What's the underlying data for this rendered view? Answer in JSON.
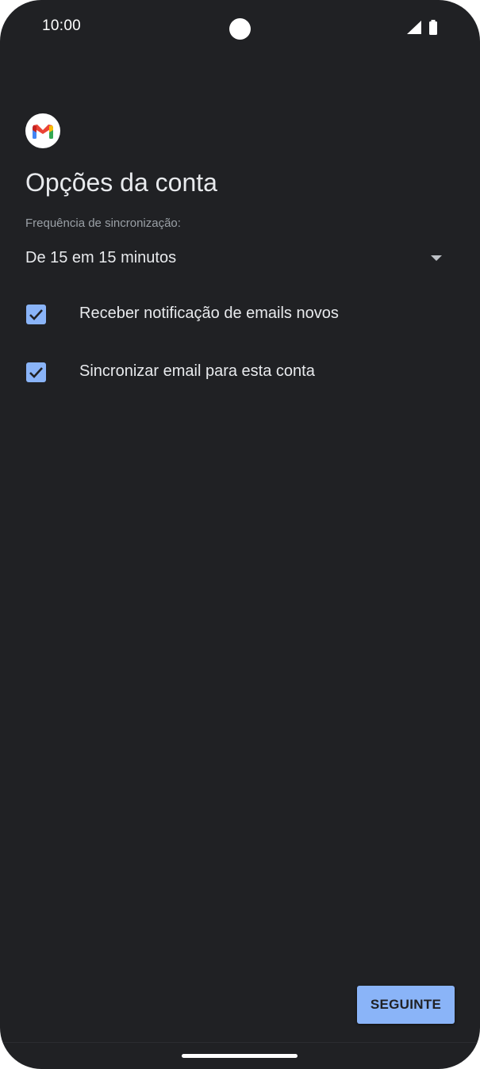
{
  "status_bar": {
    "time": "10:00",
    "icons": [
      "camera-cutout",
      "signal-icon",
      "battery-icon"
    ]
  },
  "app": {
    "logo": "gmail-logo-icon"
  },
  "page": {
    "title": "Opções da conta",
    "sync_frequency": {
      "label": "Frequência de sincronização:",
      "selected_value": "De 15 em 15 minutos"
    },
    "options": [
      {
        "label": "Receber notificação de emails novos",
        "checked": true
      },
      {
        "label": "Sincronizar email para esta conta",
        "checked": true
      }
    ],
    "next_button": {
      "label": "SEGUINTE"
    }
  },
  "colors": {
    "background": "#202124",
    "accent": "#8ab4f8",
    "text_primary": "#e8eaed",
    "text_secondary": "#9aa0a6"
  }
}
